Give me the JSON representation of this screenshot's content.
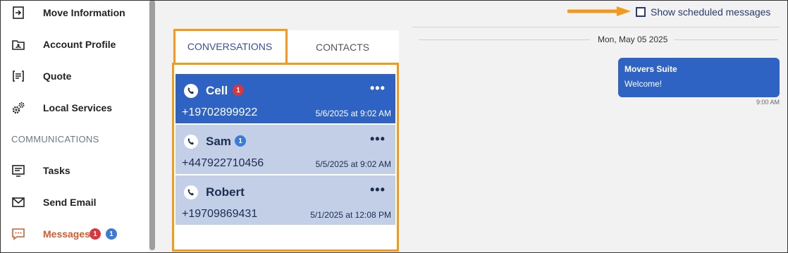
{
  "sidebar": {
    "items": [
      {
        "label": "Move Information",
        "icon": "move-in-icon"
      },
      {
        "label": "Account Profile",
        "icon": "account-folder-icon"
      },
      {
        "label": "Quote",
        "icon": "quote-list-icon"
      },
      {
        "label": "Local Services",
        "icon": "gears-icon"
      },
      {
        "label": "Tasks",
        "icon": "tasks-icon"
      },
      {
        "label": "Send Email",
        "icon": "envelope-icon"
      },
      {
        "label": "Messages",
        "icon": "chat-icon",
        "badge_red": "1",
        "badge_blue": "1"
      }
    ],
    "section_label": "COMMUNICATIONS"
  },
  "tabs": {
    "conversations": "CONVERSATIONS",
    "contacts": "CONTACTS"
  },
  "conversations": [
    {
      "name": "Cell",
      "badge": "1",
      "badge_color": "#d9363e",
      "number": "+19702899922",
      "time": "5/6/2025 at 9:02 AM",
      "more": "•••"
    },
    {
      "name": "Sam",
      "badge": "1",
      "badge_color": "#3a7bd5",
      "number": "+447922710456",
      "time": "5/5/2025 at 9:02 AM",
      "more": "•••"
    },
    {
      "name": "Robert",
      "number": "+19709869431",
      "time": "5/1/2025 at 12:08 PM",
      "more": "•••"
    }
  ],
  "scheduled": {
    "label": "Show scheduled messages",
    "checked": false
  },
  "thread": {
    "date": "Mon, May 05 2025",
    "messages": [
      {
        "sender": "Movers Suite",
        "text": "Welcome!",
        "time": "9:00 AM"
      }
    ]
  },
  "colors": {
    "accent": "#2e63c4",
    "highlight": "#f39a1e",
    "active_nav": "#d65b2a"
  }
}
